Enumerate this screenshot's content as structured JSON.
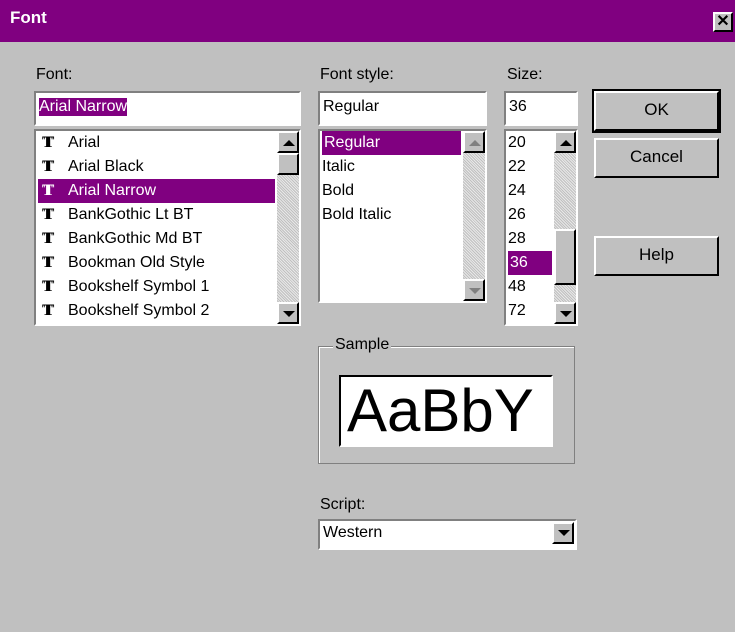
{
  "window": {
    "title": "Font",
    "close_glyph": "✕"
  },
  "font": {
    "label": "Font:",
    "value": "Arial Narrow",
    "items": [
      "Arial",
      "Arial Black",
      "Arial Narrow",
      "BankGothic Lt BT",
      "BankGothic Md BT",
      "Bookman Old Style",
      "Bookshelf Symbol 1",
      "Bookshelf Symbol 2"
    ],
    "selected_index": 2,
    "item_icon": "truetype-icon",
    "icon_glyph": "T"
  },
  "style": {
    "label": "Font style:",
    "value": "Regular",
    "items": [
      "Regular",
      "Italic",
      "Bold",
      "Bold Italic"
    ],
    "selected_index": 0
  },
  "size": {
    "label": "Size:",
    "value": "36",
    "items": [
      "20",
      "22",
      "24",
      "26",
      "28",
      "36",
      "48",
      "72"
    ],
    "selected_index": 5
  },
  "buttons": {
    "ok": "OK",
    "cancel": "Cancel",
    "help": "Help"
  },
  "sample": {
    "label": "Sample",
    "text": "AaBbY"
  },
  "script": {
    "label": "Script:",
    "value": "Western"
  },
  "colors": {
    "titlebar": "#800080",
    "selection": "#800080",
    "face": "#c0c0c0"
  }
}
